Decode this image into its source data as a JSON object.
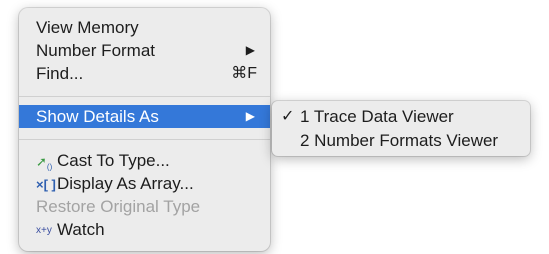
{
  "menu": {
    "items": [
      {
        "label": "View Memory"
      },
      {
        "label": "Number Format",
        "submenu_arrow": "▶"
      },
      {
        "label": "Find...",
        "shortcut": "⌘F"
      },
      {
        "label": "Show Details As",
        "submenu_arrow": "▶",
        "highlighted": true
      },
      {
        "label": "Cast To Type...",
        "icon": "cast-icon"
      },
      {
        "label": "Display As Array...",
        "icon": "array-icon",
        "icon_text": "×[ ]"
      },
      {
        "label": "Restore Original Type",
        "disabled": true
      },
      {
        "label": "Watch",
        "icon": "watch-icon",
        "icon_text": "x+y"
      }
    ]
  },
  "submenu": {
    "items": [
      {
        "label": "1 Trace Data Viewer",
        "checked": true,
        "checkmark": "✓"
      },
      {
        "label": "2 Number Formats Viewer",
        "checked": false
      }
    ]
  },
  "colors": {
    "menu_bg": "#ececec",
    "highlight": "#3478d9",
    "disabled_text": "#a3a3a3"
  }
}
